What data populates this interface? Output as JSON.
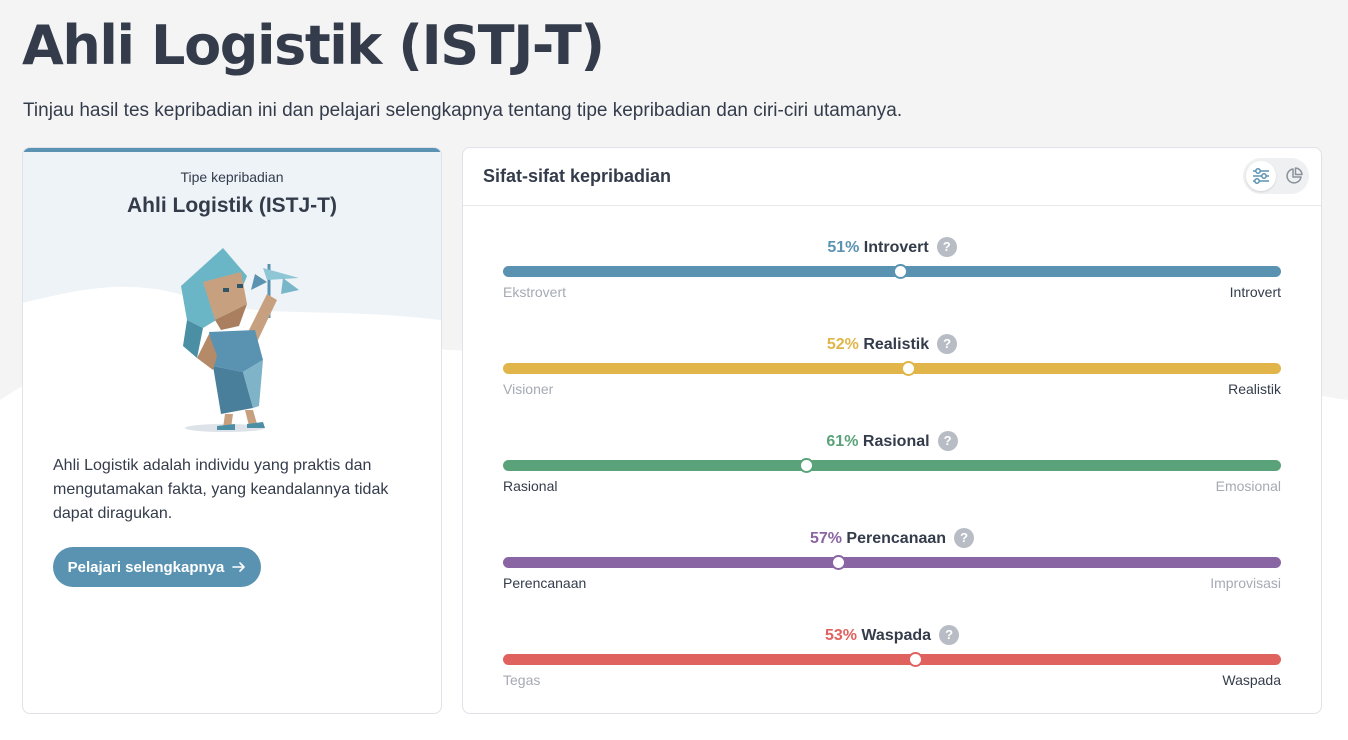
{
  "header": {
    "title": "Ahli Logistik (ISTJ-T)",
    "subtitle": "Tinjau hasil tes kepribadian ini dan pelajari selengkapnya tentang tipe kepribadian dan ciri-ciri utamanya."
  },
  "type_card": {
    "eyebrow": "Tipe kepribadian",
    "name": "Ahli Logistik (ISTJ-T)",
    "illustration": "logistician-character-illustration",
    "description": "Ahli Logistik adalah individu yang praktis dan mengutamakan fakta, yang keandalannya tidak dapat diragukan.",
    "button_label": "Pelajari selengkapnya",
    "accent": "#5a93b2"
  },
  "traits_card": {
    "title": "Sifat-sifat kepribadian",
    "toggle": {
      "active": "sliders-icon",
      "inactive": "pie-chart-icon"
    },
    "traits": [
      {
        "pct": "51%",
        "label": "Introvert",
        "left": "Ekstrovert",
        "right": "Introvert",
        "value": 0.51,
        "toward": "right",
        "color": "#5a93b2"
      },
      {
        "pct": "52%",
        "label": "Realistik",
        "left": "Visioner",
        "right": "Realistik",
        "value": 0.52,
        "toward": "right",
        "color": "#e1b54a"
      },
      {
        "pct": "61%",
        "label": "Rasional",
        "left": "Rasional",
        "right": "Emosional",
        "value": 0.61,
        "toward": "left",
        "color": "#5aa37a"
      },
      {
        "pct": "57%",
        "label": "Perencanaan",
        "left": "Perencanaan",
        "right": "Improvisasi",
        "value": 0.57,
        "toward": "left",
        "color": "#8a65a3"
      },
      {
        "pct": "53%",
        "label": "Waspada",
        "left": "Tegas",
        "right": "Waspada",
        "value": 0.53,
        "toward": "right",
        "color": "#e0625f"
      }
    ]
  }
}
